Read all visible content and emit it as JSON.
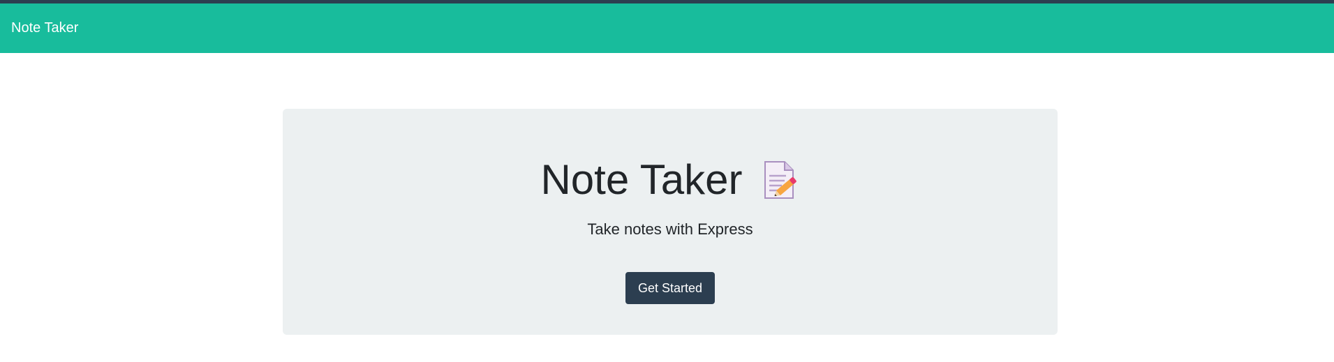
{
  "navbar": {
    "brand": "Note Taker"
  },
  "hero": {
    "title": "Note Taker",
    "icon": "memo-icon",
    "subtitle": "Take notes with Express",
    "cta_label": "Get Started"
  },
  "colors": {
    "navbar_bg": "#18bc9c",
    "top_edge": "#2c3e50",
    "jumbotron_bg": "#ecf0f1",
    "button_bg": "#2c3e50",
    "text": "#212529"
  }
}
